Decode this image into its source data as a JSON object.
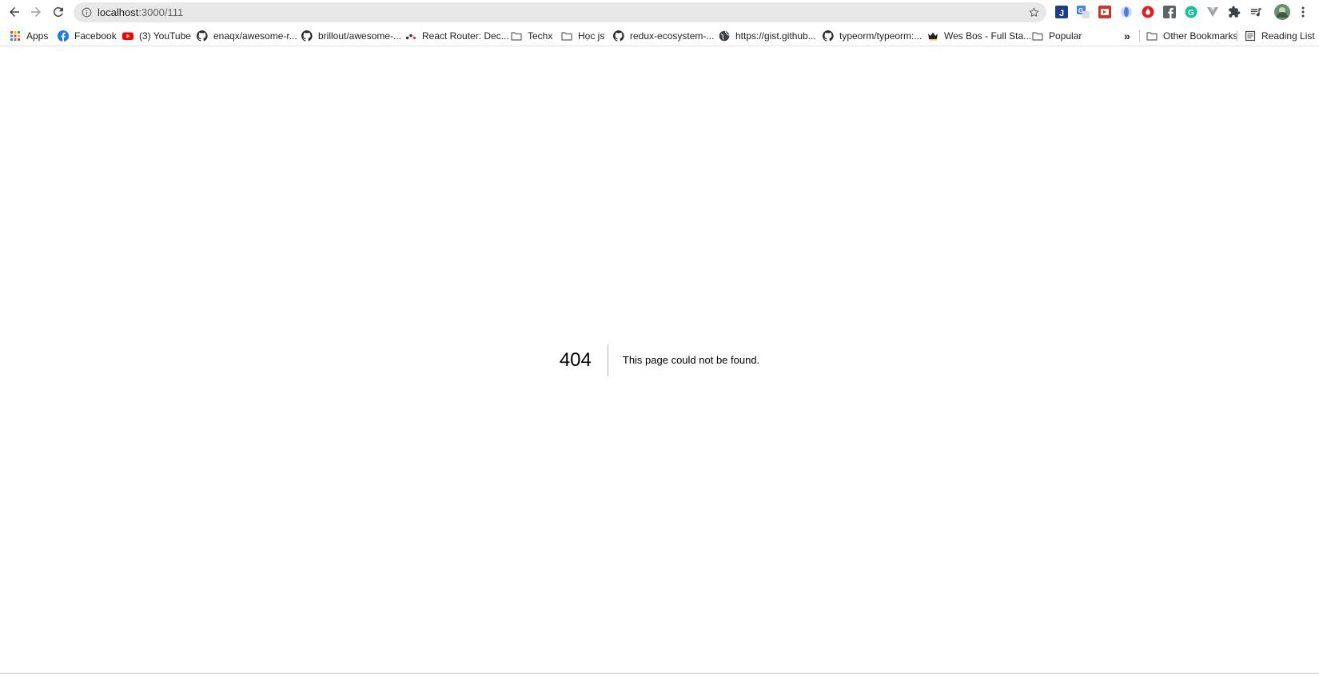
{
  "browser": {
    "url_host": "localhost",
    "url_path": ":3000/111"
  },
  "bookmarks": {
    "items": [
      {
        "label": "Apps",
        "icon": "apps-grid-icon"
      },
      {
        "label": "Facebook",
        "icon": "facebook-icon"
      },
      {
        "label": "(3) YouTube",
        "icon": "youtube-icon"
      },
      {
        "label": "enaqx/awesome-r...",
        "icon": "github-icon"
      },
      {
        "label": "brillout/awesome-...",
        "icon": "github-icon"
      },
      {
        "label": "React Router: Dec...",
        "icon": "react-router-icon"
      },
      {
        "label": "Techx",
        "icon": "folder-icon"
      },
      {
        "label": "Học js",
        "icon": "folder-icon"
      },
      {
        "label": "redux-ecosystem-...",
        "icon": "github-icon"
      },
      {
        "label": "https://gist.github...",
        "icon": "globe-icon"
      },
      {
        "label": "typeorm/typeorm:...",
        "icon": "github-icon"
      },
      {
        "label": "Wes Bos - Full Sta...",
        "icon": "crown-icon"
      },
      {
        "label": "Popular",
        "icon": "folder-icon"
      }
    ],
    "overflow_label": "»",
    "other_bookmarks": "Other Bookmarks",
    "reading_list": "Reading List"
  },
  "page": {
    "code": "404",
    "message": "This page could not be found."
  },
  "colors": {
    "omnibox_bg": "#e8e8e8",
    "youtube_red": "#ff0000",
    "facebook_blue": "#1877f2"
  }
}
